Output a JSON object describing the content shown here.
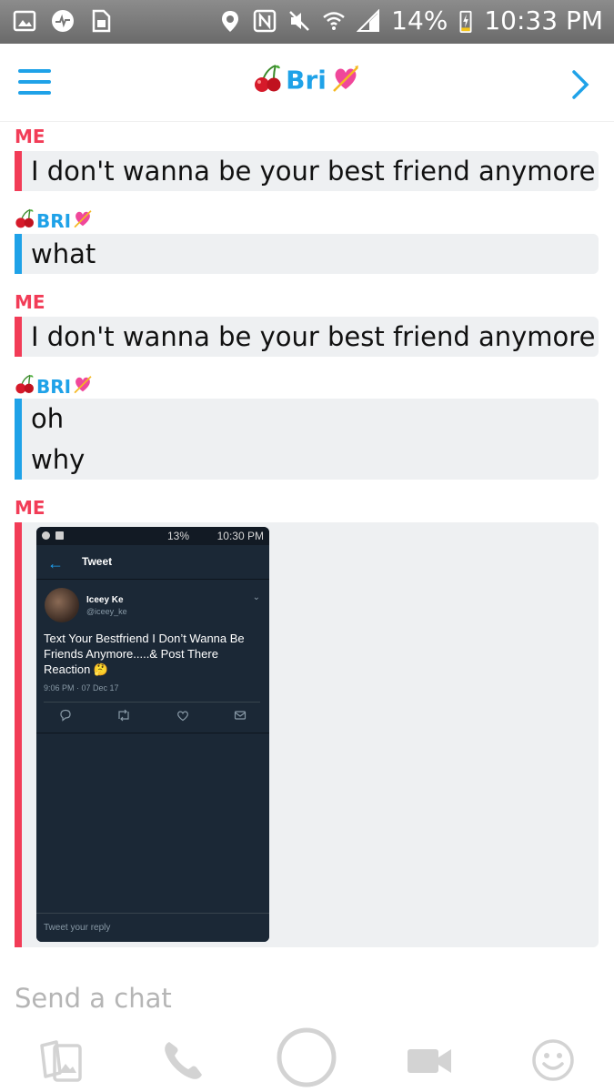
{
  "status_bar": {
    "battery": "14%",
    "time": "10:33 PM"
  },
  "header": {
    "title": "Bri",
    "title_emoji_left": "cherries-emoji",
    "title_emoji_right": "heart-with-arrow-emoji",
    "accent_color": "#1fa2e8"
  },
  "colors": {
    "me": "#f23c57",
    "friend": "#1fa2e8",
    "bubble_bg": "#eef0f2"
  },
  "messages": [
    {
      "sender_label": "ME",
      "lines": [
        "I don't wanna be your best friend anymore"
      ]
    },
    {
      "sender_label": "BRI",
      "lines": [
        "what"
      ]
    },
    {
      "sender_label": "ME",
      "lines": [
        "I don't wanna be your best friend anymore"
      ]
    },
    {
      "sender_label": "BRI",
      "lines": [
        "oh",
        "why"
      ]
    },
    {
      "sender_label": "ME",
      "attachment": "tweet-screenshot"
    }
  ],
  "tweet": {
    "status_battery": "13%",
    "status_time": "10:30 PM",
    "screen_title": "Tweet",
    "author_name": "Iceey Ke",
    "author_handle": "@iceey_ke",
    "text": "Text Your Bestfriend I Don’t Wanna Be Friends Anymore.....& Post There Reaction 🤔",
    "timestamp": "9:06 PM · 07 Dec 17",
    "reply_placeholder": "Tweet your reply"
  },
  "composer": {
    "placeholder": "Send a chat"
  },
  "bottom_icons": [
    "memories-icon",
    "phone-icon",
    "capture-button",
    "video-icon",
    "emoji-icon"
  ]
}
